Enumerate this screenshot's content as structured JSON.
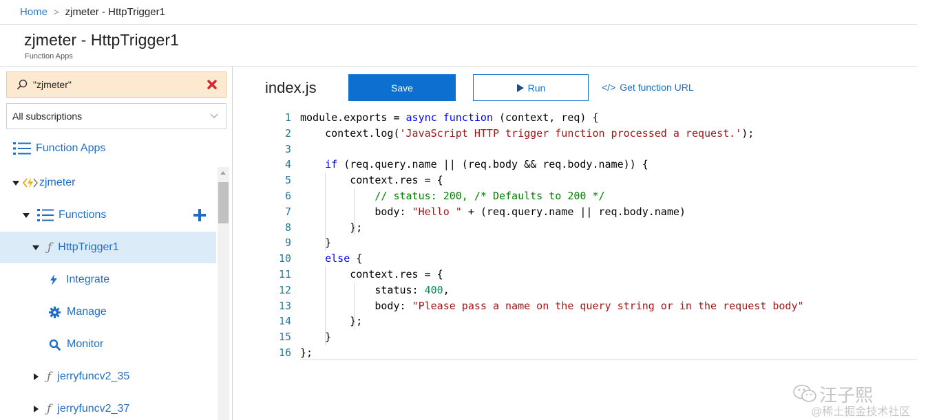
{
  "breadcrumb": {
    "home": "Home",
    "separator": ">",
    "current": "zjmeter - HttpTrigger1"
  },
  "header": {
    "title": "zjmeter - HttpTrigger1",
    "subtitle": "Function Apps"
  },
  "sidebar": {
    "search_value": "\"zjmeter\"",
    "subscription_select": "All subscriptions",
    "function_apps_label": "Function Apps",
    "tree": [
      {
        "label": "zjmeter",
        "icon": "function-app-lightning-icon"
      },
      {
        "label": "Functions",
        "icon": "list-icon"
      },
      {
        "label": "HttpTrigger1",
        "icon": "function-f-icon",
        "selected": true
      },
      {
        "label": "Integrate",
        "icon": "lightning-icon"
      },
      {
        "label": "Manage",
        "icon": "gear-icon"
      },
      {
        "label": "Monitor",
        "icon": "search-icon"
      },
      {
        "label": "jerryfuncv2_35",
        "icon": "function-f-icon"
      },
      {
        "label": "jerryfuncv2_37",
        "icon": "function-f-icon"
      }
    ]
  },
  "editor": {
    "file_name": "index.js",
    "save_label": "Save",
    "run_label": "Run",
    "get_url_icon": "</>",
    "get_url_label": "Get function URL",
    "lines": [
      {
        "n": "1",
        "segs": [
          [
            "",
            "module."
          ],
          [
            "",
            "exports = "
          ],
          [
            "kw",
            "async"
          ],
          [
            "",
            " "
          ],
          [
            "kw",
            "function"
          ],
          [
            "",
            " (context, req) {"
          ]
        ]
      },
      {
        "n": "2",
        "segs": [
          [
            "",
            "    context.log("
          ],
          [
            "str",
            "'JavaScript HTTP trigger function processed a request.'"
          ],
          [
            "",
            ");"
          ]
        ]
      },
      {
        "n": "3",
        "segs": [
          [
            "",
            ""
          ]
        ]
      },
      {
        "n": "4",
        "segs": [
          [
            "",
            "    "
          ],
          [
            "kw",
            "if"
          ],
          [
            "",
            " (req.query.name || (req.body && req.body.name)) {"
          ]
        ]
      },
      {
        "n": "5",
        "segs": [
          [
            "",
            "        context.res = {"
          ]
        ]
      },
      {
        "n": "6",
        "segs": [
          [
            "",
            "            "
          ],
          [
            "cm",
            "// status: 200, /* Defaults to 200 */"
          ]
        ]
      },
      {
        "n": "7",
        "segs": [
          [
            "",
            "            body: "
          ],
          [
            "str",
            "\"Hello \""
          ],
          [
            "",
            " + (req.query.name || req.body.name)"
          ]
        ]
      },
      {
        "n": "8",
        "segs": [
          [
            "",
            "        };"
          ]
        ]
      },
      {
        "n": "9",
        "segs": [
          [
            "",
            "    }"
          ]
        ]
      },
      {
        "n": "10",
        "segs": [
          [
            "",
            "    "
          ],
          [
            "kw",
            "else"
          ],
          [
            "",
            " {"
          ]
        ]
      },
      {
        "n": "11",
        "segs": [
          [
            "",
            "        context.res = {"
          ]
        ]
      },
      {
        "n": "12",
        "segs": [
          [
            "",
            "            status: "
          ],
          [
            "num",
            "400"
          ],
          [
            "",
            ","
          ]
        ]
      },
      {
        "n": "13",
        "segs": [
          [
            "",
            "            body: "
          ],
          [
            "str",
            "\"Please pass a name on the query string or in the request body\""
          ]
        ]
      },
      {
        "n": "14",
        "segs": [
          [
            "",
            "        };"
          ]
        ]
      },
      {
        "n": "15",
        "segs": [
          [
            "",
            "    }"
          ]
        ]
      },
      {
        "n": "16",
        "segs": [
          [
            "",
            "};"
          ]
        ]
      }
    ]
  },
  "watermark": {
    "title": "汪子熙",
    "subtitle": "@稀土掘金技术社区"
  },
  "colors": {
    "accent": "#0d6fd0",
    "link": "#1f6ec6",
    "search_bg": "#fde9cf",
    "selected_bg": "#dcebf8",
    "close_red": "#d9232a"
  }
}
